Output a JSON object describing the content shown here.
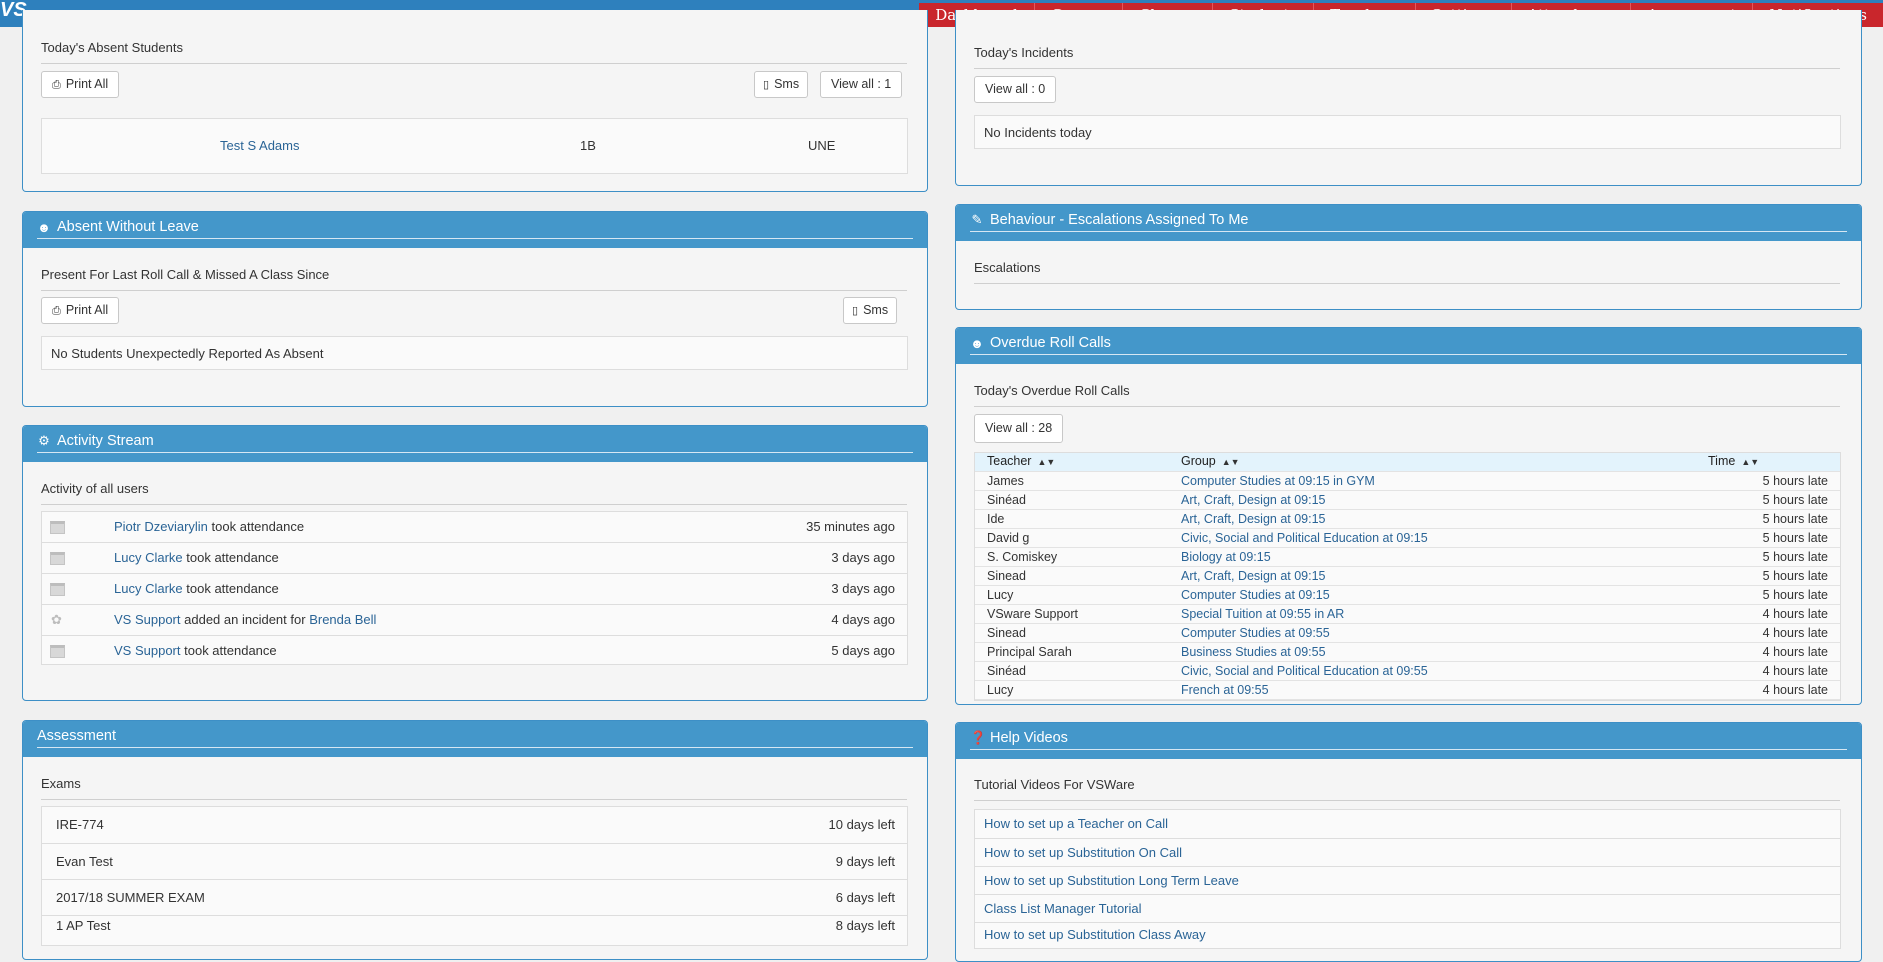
{
  "app": {
    "logo": "VS"
  },
  "nav": [
    "Dashboard",
    "Groups",
    "Classes",
    "Students",
    "Teachers",
    "Settings",
    "Attendance",
    "Assessment",
    "Notifications"
  ],
  "absent_today": {
    "title": "Today's Absent Students",
    "print_label": "Print All",
    "sms_label": "Sms",
    "view_all_label": "View all : 1",
    "students": [
      {
        "name": "Test S Adams",
        "group": "1B",
        "code": "UNE"
      }
    ]
  },
  "awol": {
    "title": "Absent Without Leave",
    "subtitle": "Present For Last Roll Call & Missed A Class Since",
    "print_label": "Print All",
    "sms_label": "Sms",
    "empty_text": "No Students Unexpectedly Reported As Absent"
  },
  "activity": {
    "title": "Activity Stream",
    "subtitle": "Activity of all users",
    "items": [
      {
        "icon": "calendar-icon",
        "user": "Piotr Dzeviarylin",
        "action": "took attendance",
        "target": "",
        "time": "35 minutes ago"
      },
      {
        "icon": "calendar-icon",
        "user": "Lucy Clarke",
        "action": "took attendance",
        "target": "",
        "time": "3 days ago"
      },
      {
        "icon": "calendar-icon",
        "user": "Lucy Clarke",
        "action": "took attendance",
        "target": "",
        "time": "3 days ago"
      },
      {
        "icon": "award-icon",
        "user": "VS Support",
        "action": "added an incident for",
        "target": "Brenda Bell",
        "time": "4 days ago"
      },
      {
        "icon": "calendar-icon",
        "user": "VS Support",
        "action": "took attendance",
        "target": "",
        "time": "5 days ago"
      }
    ]
  },
  "assessment": {
    "title": "Assessment",
    "subtitle": "Exams",
    "exams": [
      {
        "name": "IRE-774",
        "left": "10 days left"
      },
      {
        "name": "Evan Test",
        "left": "9 days left"
      },
      {
        "name": "2017/18 SUMMER EXAM",
        "left": "6 days left"
      },
      {
        "name": "1 AP Test",
        "left": "8 days left"
      }
    ]
  },
  "incidents": {
    "title": "Today's Incidents",
    "view_all_label": "View all : 0",
    "empty_text": "No Incidents today"
  },
  "escalations": {
    "title": "Behaviour - Escalations Assigned To Me",
    "subtitle": "Escalations"
  },
  "overdue": {
    "title": "Overdue Roll Calls",
    "subtitle": "Today's Overdue Roll Calls",
    "view_all_label": "View all : 28",
    "columns": {
      "teacher": "Teacher",
      "group": "Group",
      "time": "Time"
    },
    "rows": [
      {
        "teacher": "James",
        "group": "Computer Studies at 09:15 in GYM",
        "time": "5 hours late"
      },
      {
        "teacher": "Sinéad",
        "group": "Art, Craft, Design at 09:15",
        "time": "5 hours late"
      },
      {
        "teacher": "Ide",
        "group": "Art, Craft, Design at 09:15",
        "time": "5 hours late"
      },
      {
        "teacher": "David g",
        "group": "Civic, Social and Political Education at 09:15",
        "time": "5 hours late"
      },
      {
        "teacher": "S. Comiskey",
        "group": "Biology at 09:15",
        "time": "5 hours late"
      },
      {
        "teacher": "Sinead",
        "group": "Art, Craft, Design at 09:15",
        "time": "5 hours late"
      },
      {
        "teacher": "Lucy",
        "group": "Computer Studies at 09:15",
        "time": "5 hours late"
      },
      {
        "teacher": "VSware Support",
        "group": "Special Tuition at 09:55 in AR",
        "time": "4 hours late"
      },
      {
        "teacher": "Sinead",
        "group": "Computer Studies at 09:55",
        "time": "4 hours late"
      },
      {
        "teacher": "Principal Sarah",
        "group": "Business Studies at 09:55",
        "time": "4 hours late"
      },
      {
        "teacher": "Sinéad",
        "group": "Civic, Social and Political Education at 09:55",
        "time": "4 hours late"
      },
      {
        "teacher": "Lucy",
        "group": "French at 09:55",
        "time": "4 hours late"
      }
    ]
  },
  "help": {
    "title": "Help Videos",
    "subtitle": "Tutorial Videos For VSWare",
    "videos": [
      "How to set up a Teacher on Call",
      "How to set up Substitution On Call",
      "How to set up Substitution Long Term Leave",
      "Class List Manager Tutorial",
      "How to set up Substitution Class Away"
    ]
  }
}
